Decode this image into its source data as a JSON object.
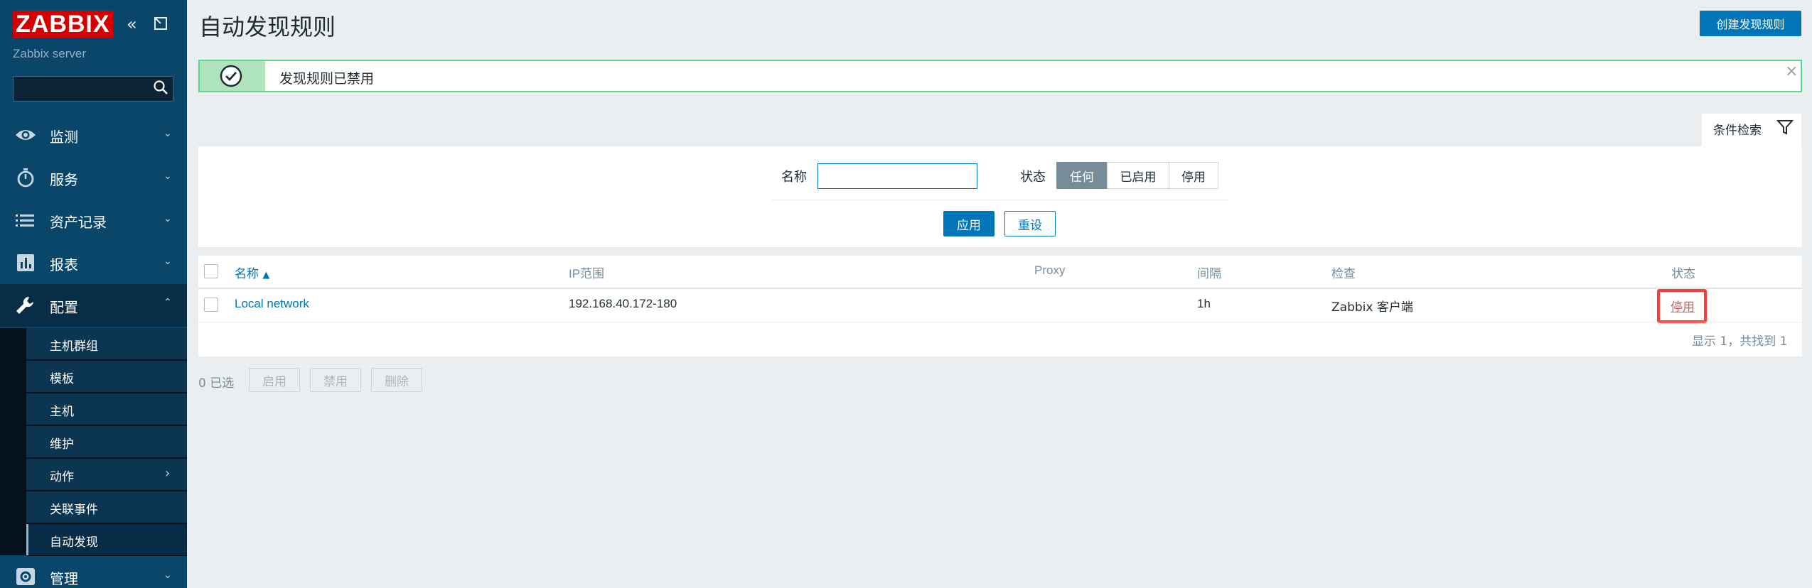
{
  "sidebar": {
    "logo": "ZABBIX",
    "server_name": "Zabbix server",
    "search_placeholder": "",
    "nav": [
      {
        "label": "监测",
        "icon": "eye-icon"
      },
      {
        "label": "服务",
        "icon": "stopwatch-icon"
      },
      {
        "label": "资产记录",
        "icon": "list-icon"
      },
      {
        "label": "报表",
        "icon": "bar-chart-icon"
      },
      {
        "label": "配置",
        "icon": "wrench-icon"
      },
      {
        "label": "管理",
        "icon": "gear-icon"
      }
    ],
    "submenu": [
      {
        "label": "主机群组"
      },
      {
        "label": "模板"
      },
      {
        "label": "主机"
      },
      {
        "label": "维护"
      },
      {
        "label": "动作"
      },
      {
        "label": "关联事件"
      },
      {
        "label": "自动发现"
      }
    ]
  },
  "header": {
    "title": "自动发现规则",
    "create_label": "创建发现规则"
  },
  "message": {
    "text": "发现规则已禁用"
  },
  "filter": {
    "tab_label": "条件检索",
    "name_label": "名称",
    "name_value": "",
    "status_label": "状态",
    "status_options": [
      "任何",
      "已启用",
      "停用"
    ],
    "status_selected": "任何",
    "apply_label": "应用",
    "reset_label": "重设"
  },
  "table": {
    "headers": {
      "name": "名称",
      "ip_range": "IP范围",
      "proxy": "Proxy",
      "interval": "间隔",
      "checks": "检查",
      "status": "状态"
    },
    "rows": [
      {
        "name": "Local network",
        "ip_range": "192.168.40.172-180",
        "proxy": "",
        "interval": "1h",
        "checks": "Zabbix 客户端",
        "status": "停用"
      }
    ],
    "pager_info": "显示 1，共找到 1"
  },
  "mass_actions": {
    "selected": "0 已选",
    "enable_label": "启用",
    "disable_label": "禁用",
    "delete_label": "删除"
  },
  "colors": {
    "sidebar_bg": "#0a466a",
    "accent": "#0275b8",
    "disabled_status": "#e45959",
    "success_border": "#59db8f"
  }
}
